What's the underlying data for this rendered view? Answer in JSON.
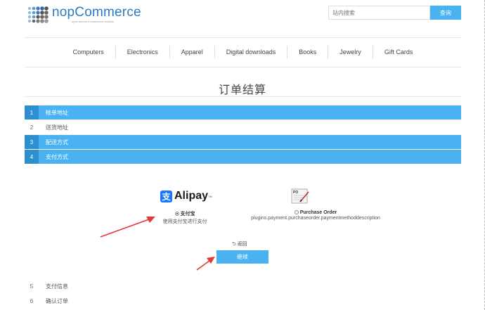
{
  "header": {
    "logo_brand": "nopCommerce",
    "logo_tagline": "open source e-commerce solution",
    "search_placeholder": "站内搜索",
    "search_button": "查询"
  },
  "menu": [
    "Computers",
    "Electronics",
    "Apparel",
    "Digital downloads",
    "Books",
    "Jewelry",
    "Gift Cards"
  ],
  "page_title": "订单结算",
  "steps": [
    {
      "num": "1",
      "label": "帐单地址"
    },
    {
      "num": "2",
      "label": "送货地址"
    },
    {
      "num": "3",
      "label": "配送方式"
    },
    {
      "num": "4",
      "label": "支付方式"
    },
    {
      "num": "5",
      "label": "支付信息"
    },
    {
      "num": "6",
      "label": "确认订单"
    }
  ],
  "payment": {
    "alipay_logo": "Alipay",
    "alipay_tm": "TM",
    "alipay_icon": "支",
    "option1_name": "支付宝",
    "option1_desc": "使用支付宝进行支付",
    "option2_name": "Purchase Order",
    "option2_desc": "plugins.payment.purchaseorder.paymentmethoddescription",
    "po_icon_text": "PO"
  },
  "actions": {
    "back": "返回",
    "continue": "继续"
  },
  "colors": {
    "accent": "#4ab2f1",
    "accent_dark": "#2e8fcf",
    "annotation_arrow": "#e53935"
  }
}
